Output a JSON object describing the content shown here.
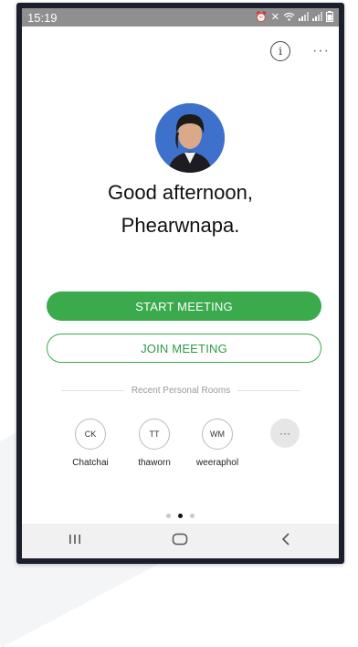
{
  "status_bar": {
    "time": "15:19",
    "icons": [
      "alarm-icon",
      "mute-icon",
      "wifi-icon",
      "signal-icon",
      "signal-icon",
      "battery-icon"
    ]
  },
  "header": {
    "info_label": "i",
    "more_label": "···"
  },
  "profile": {
    "greeting_line1": "Good afternoon,",
    "greeting_line2": "Phearwnapa."
  },
  "actions": {
    "start_meeting": "START MEETING",
    "join_meeting": "JOIN MEETING"
  },
  "recent_rooms": {
    "label": "Recent Personal Rooms",
    "rooms": [
      {
        "initials": "CK",
        "name": "Chatchai"
      },
      {
        "initials": "TT",
        "name": "thaworn"
      },
      {
        "initials": "WM",
        "name": "weeraphol"
      }
    ],
    "more_label": "···"
  },
  "pager": {
    "pages": 3,
    "active_index": 1
  },
  "nav_bar": {
    "recents_icon": "recents-icon",
    "home_icon": "home-icon",
    "back_icon": "back-icon"
  },
  "colors": {
    "accent": "#3aaa4d",
    "status_bar": "#8f8f8f",
    "phone_frame": "#1a1f2b"
  }
}
